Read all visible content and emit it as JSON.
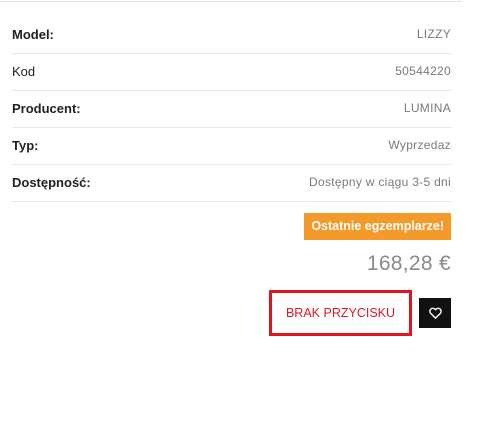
{
  "specs": [
    {
      "label": "Model:",
      "value": "LIZZY"
    },
    {
      "label": "Kod",
      "value": "50544220"
    },
    {
      "label": "Producent:",
      "value": "LUMINA"
    },
    {
      "label": "Typ:",
      "value": "Wyprzedaz"
    },
    {
      "label": "Dostępność:",
      "value": "Dostępny w ciągu 3-5 dni"
    }
  ],
  "badge": "Ostatnie egzemplarze!",
  "price": "168,28 €",
  "missing_button_label": "BRAK PRZYCISKU",
  "wishlist_icon": "heart-icon",
  "colors": {
    "badge": "#f39a2b",
    "highlight_border": "#e0141e",
    "wishlist_bg": "#111111"
  }
}
